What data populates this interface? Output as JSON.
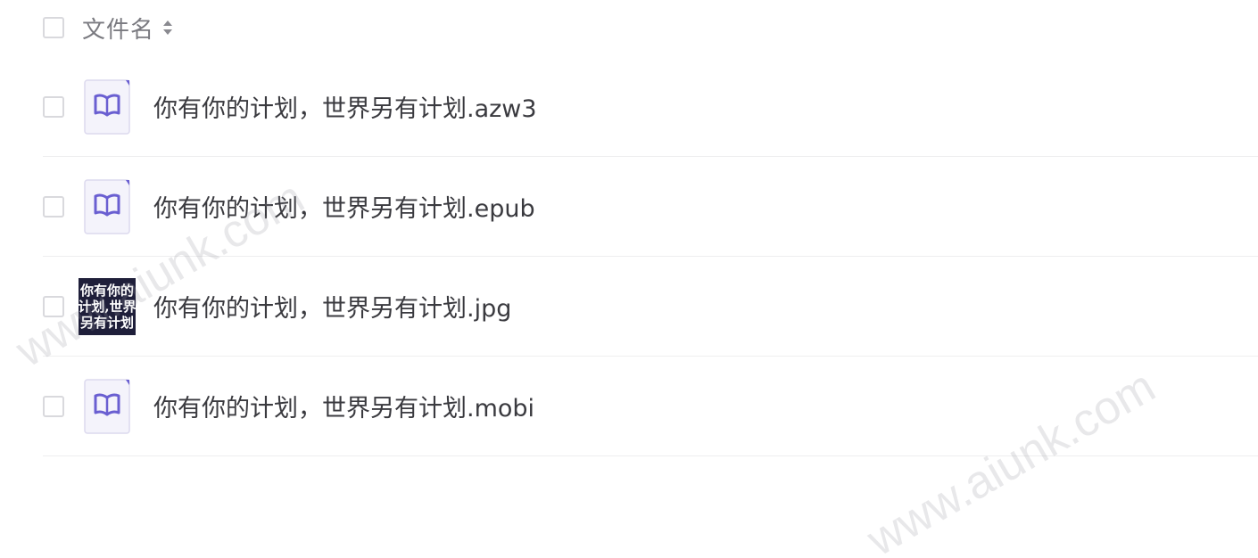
{
  "header": {
    "column_label": "文件名"
  },
  "files": [
    {
      "name": "你有你的计划，世界另有计划.azw3",
      "icon": "ebook-icon",
      "thumb_lines": []
    },
    {
      "name": "你有你的计划，世界另有计划.epub",
      "icon": "ebook-icon",
      "thumb_lines": []
    },
    {
      "name": "你有你的计划，世界另有计划.jpg",
      "icon": "image-thumbnail",
      "thumb_lines": [
        "你有你的",
        "计划,世界",
        "另有计划"
      ]
    },
    {
      "name": "你有你的计划，世界另有计划.mobi",
      "icon": "ebook-icon",
      "thumb_lines": []
    }
  ],
  "watermark": "www.aiunk.com",
  "colors": {
    "icon_accent": "#6a5fd1",
    "icon_bg": "#f4f3fb",
    "icon_border": "#dcd9ee"
  }
}
